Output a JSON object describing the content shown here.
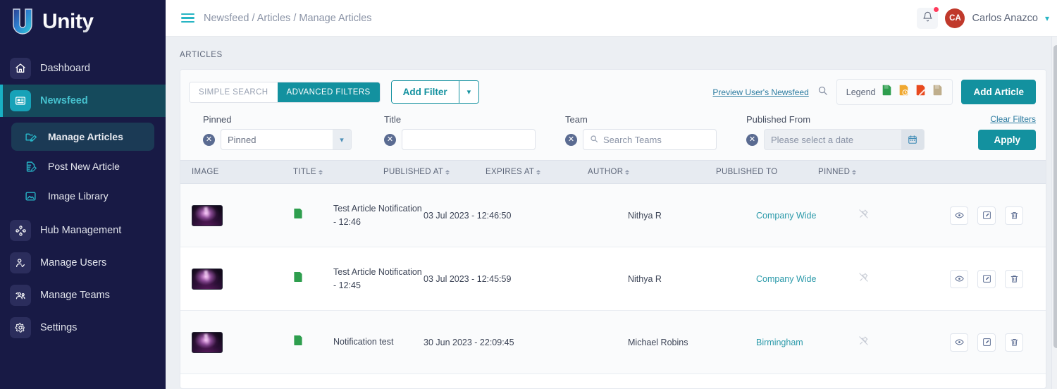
{
  "brand": {
    "name": "Unity",
    "logo_icon": "unity-u-logo",
    "accent": "#13919f",
    "sidebar_bg": "#181a45"
  },
  "sidebar": {
    "items": [
      {
        "label": "Dashboard",
        "icon": "home-icon",
        "active": false
      },
      {
        "label": "Newsfeed",
        "icon": "newsfeed-icon",
        "active": true
      },
      {
        "label": "Hub Management",
        "icon": "hub-icon",
        "active": false
      },
      {
        "label": "Manage Users",
        "icon": "user-check-icon",
        "active": false
      },
      {
        "label": "Manage Teams",
        "icon": "team-icon",
        "active": false
      },
      {
        "label": "Settings",
        "icon": "gear-icon",
        "active": false
      }
    ],
    "sub_items": [
      {
        "label": "Manage Articles",
        "icon": "folder-edit-icon",
        "selected": true
      },
      {
        "label": "Post New Article",
        "icon": "file-edit-icon",
        "selected": false
      },
      {
        "label": "Image Library",
        "icon": "image-icon",
        "selected": false
      }
    ]
  },
  "topbar": {
    "menu_icon": "hamburger-icon",
    "breadcrumb": "Newsfeed / Articles / Manage Articles",
    "bell_icon": "bell-icon",
    "has_notification": true,
    "user": {
      "initials": "CA",
      "name": "Carlos Anazco",
      "avatar_color": "#c0392b",
      "caret_icon": "chevron-down-icon"
    }
  },
  "page": {
    "title": "ARTICLES"
  },
  "toolbar": {
    "simple_search_label": "SIMPLE SEARCH",
    "advanced_filters_label": "ADVANCED FILTERS",
    "active_tab": "ADVANCED FILTERS",
    "add_filter_label": "Add Filter",
    "add_filter_caret_icon": "chevron-down-icon",
    "preview_link": "Preview User's Newsfeed",
    "search_icon": "search-icon",
    "legend_label": "Legend",
    "legend_icons": [
      {
        "name": "published-icon",
        "color": "#2e9e4e",
        "badge": "check"
      },
      {
        "name": "scheduled-icon",
        "color": "#f0a830",
        "badge": "clock"
      },
      {
        "name": "draft-icon",
        "color": "#e8491e",
        "badge": "pencil"
      },
      {
        "name": "expired-icon",
        "color": "#bfae8c",
        "badge": "none"
      }
    ],
    "add_article_label": "Add Article"
  },
  "filters": {
    "clear_icon": "clear-circle-icon",
    "fields": [
      {
        "label": "Pinned",
        "type": "select",
        "value": "Pinned",
        "caret_icon": "chevron-down-icon"
      },
      {
        "label": "Title",
        "type": "text",
        "value": "",
        "placeholder": ""
      },
      {
        "label": "Team",
        "type": "search",
        "value": "",
        "placeholder": "Search Teams",
        "icon": "search-icon"
      },
      {
        "label": "Published From",
        "type": "date",
        "value": "",
        "placeholder": "Please select a date",
        "icon": "calendar-icon"
      }
    ],
    "clear_filters_label": "Clear Filters",
    "apply_label": "Apply"
  },
  "table": {
    "columns": [
      {
        "label": "IMAGE",
        "sortable": false
      },
      {
        "label": "TITLE",
        "sortable": true
      },
      {
        "label": "PUBLISHED AT",
        "sortable": true
      },
      {
        "label": "EXPIRES AT",
        "sortable": true
      },
      {
        "label": "AUTHOR",
        "sortable": true
      },
      {
        "label": "PUBLISHED TO",
        "sortable": false
      },
      {
        "label": "PINNED",
        "sortable": true
      }
    ],
    "rows": [
      {
        "thumbnail": "article-thumbnail",
        "status_icon": "published-icon",
        "title": "Test Article Notification - 12:46",
        "published_at": "03 Jul 2023 - 12:46:50",
        "expires_at": "",
        "author": "Nithya R",
        "published_to": "Company Wide",
        "pinned": false,
        "pinned_icon": "pin-off-icon"
      },
      {
        "thumbnail": "article-thumbnail",
        "status_icon": "published-icon",
        "title": "Test Article Notification - 12:45",
        "published_at": "03 Jul 2023 - 12:45:59",
        "expires_at": "",
        "author": "Nithya R",
        "published_to": "Company Wide",
        "pinned": false,
        "pinned_icon": "pin-off-icon"
      },
      {
        "thumbnail": "article-thumbnail",
        "status_icon": "published-icon",
        "title": "Notification test",
        "published_at": "30 Jun 2023 - 22:09:45",
        "expires_at": "",
        "author": "Michael Robins",
        "published_to": "Birmingham",
        "pinned": false,
        "pinned_icon": "pin-off-icon"
      }
    ],
    "row_actions": [
      {
        "name": "view-button",
        "icon": "eye-icon"
      },
      {
        "name": "edit-button",
        "icon": "pencil-square-icon"
      },
      {
        "name": "delete-button",
        "icon": "trash-icon"
      }
    ]
  }
}
